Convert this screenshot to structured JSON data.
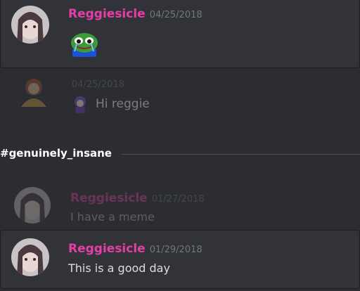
{
  "messages": [
    {
      "username": "Reggiesicle",
      "date": "04/25/2018",
      "content_emoji": "pepe-cry-emoji"
    },
    {
      "username": "",
      "date": "04/25/2018",
      "content": "Hi reggie",
      "content_emoji": "character-emoji"
    },
    {
      "username": "Reggiesicle",
      "date": "01/27/2018",
      "content": "I have a meme"
    },
    {
      "username": "Reggiesicle",
      "date": "01/29/2018",
      "content": "This is a good day"
    }
  ],
  "divider": {
    "channel": "#genuinely_insane"
  },
  "colors": {
    "username": "#e43fa6",
    "background": "#2b2d31",
    "card": "#313338",
    "text": "#dcddde"
  }
}
